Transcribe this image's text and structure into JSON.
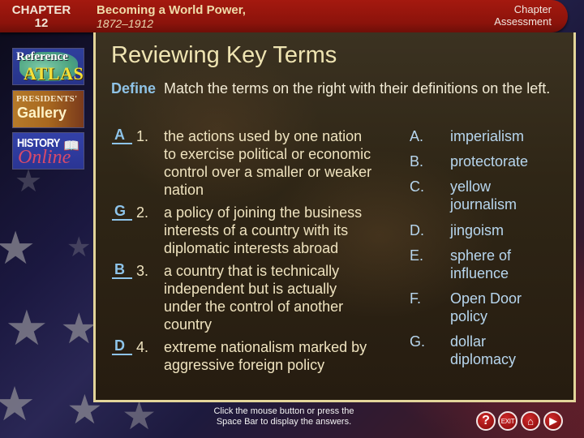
{
  "header": {
    "chapter_label": "CHAPTER",
    "chapter_number": "12",
    "book_title": "Becoming a World Power,",
    "book_years": "1872–1912",
    "assessment_button": [
      "Chapter",
      "Assessment"
    ]
  },
  "sidebar": {
    "items": [
      {
        "line1": "Reference",
        "line2": "ATLAS"
      },
      {
        "line1": "PRESIDENTS'",
        "line2": "Gallery"
      },
      {
        "line1": "HISTORY",
        "line2": "Online"
      }
    ]
  },
  "main": {
    "title": "Reviewing Key Terms",
    "instruction_keyword": "Define",
    "instruction_text": "Match the terms on the right with their definitions on the left.",
    "definitions": [
      {
        "answer": "A",
        "number": "1.",
        "text": "the actions used by one nation to exercise political or economic control over a smaller or weaker nation"
      },
      {
        "answer": "G",
        "number": "2.",
        "text": "a policy of joining the business interests of a country with its diplomatic interests abroad"
      },
      {
        "answer": "B",
        "number": "3.",
        "text": "a country that is technically independent but is actually under the control of another country"
      },
      {
        "answer": "D",
        "number": "4.",
        "text": "extreme nationalism marked by aggressive foreign policy"
      }
    ],
    "terms": [
      {
        "letter": "A.",
        "text": "imperialism"
      },
      {
        "letter": "B.",
        "text": "protectorate"
      },
      {
        "letter": "C.",
        "text": "yellow journalism"
      },
      {
        "letter": "D.",
        "text": "jingoism"
      },
      {
        "letter": "E.",
        "text": "sphere of influence"
      },
      {
        "letter": "F.",
        "text": "Open Door policy"
      },
      {
        "letter": "G.",
        "text": "dollar diplomacy"
      }
    ]
  },
  "footer": {
    "note_line1": "Click the mouse button or press the",
    "note_line2": "Space Bar to display the answers.",
    "buttons": {
      "help": "?",
      "exit": "EXIT",
      "home": "⌂",
      "next": "▶"
    }
  },
  "colors": {
    "header_red": "#8c130b",
    "title_cream": "#efe4b2",
    "answer_blue": "#8ec4ea",
    "term_blue": "#b7d6ee",
    "frame_gold": "#e3d59a"
  }
}
